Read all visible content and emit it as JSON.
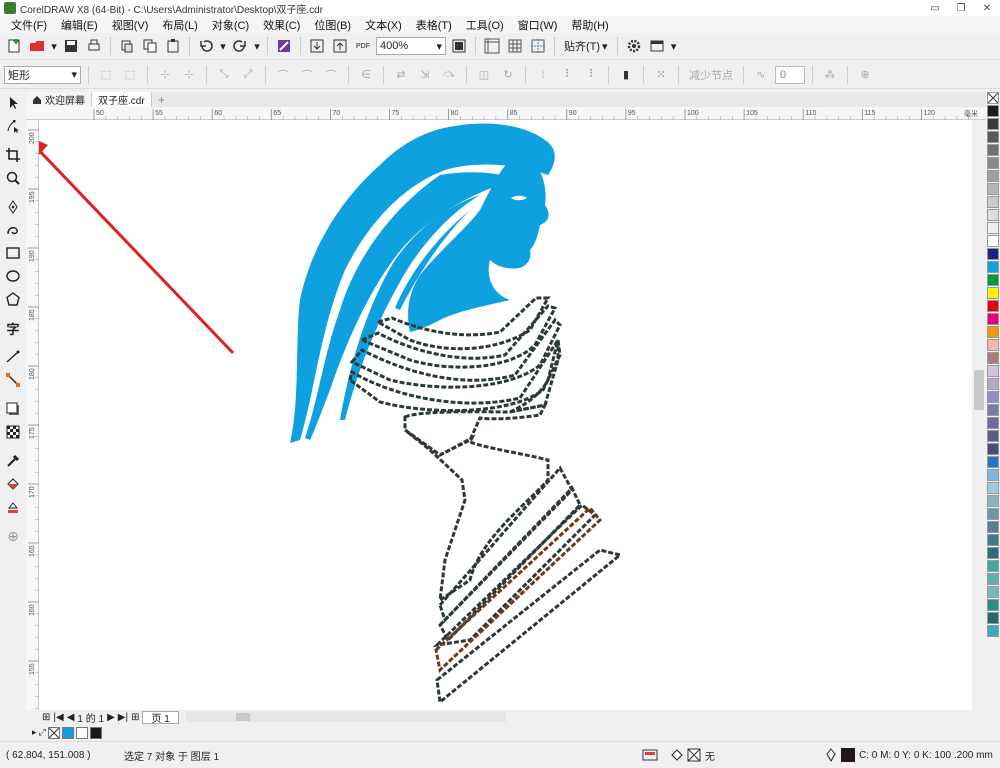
{
  "window": {
    "title": "CorelDRAW X8 (64-Bit) - C:\\Users\\Administrator\\Desktop\\双子座.cdr"
  },
  "menu": [
    "文件(F)",
    "编辑(E)",
    "视图(V)",
    "布局(L)",
    "对象(C)",
    "效果(C)",
    "位图(B)",
    "文本(X)",
    "表格(T)",
    "工具(O)",
    "窗口(W)",
    "帮助(H)"
  ],
  "toolbar": {
    "zoom_value": "400%",
    "snap_label": "贴齐(T)",
    "pdf_label": "PDF"
  },
  "property_bar": {
    "shape_type": "矩形",
    "reduce_nodes_label": "减少节点",
    "curve_smoothness": "0"
  },
  "tabs": [
    {
      "label": "欢迎屏幕"
    },
    {
      "label": "双子座.cdr"
    }
  ],
  "ruler": {
    "h_ticks": [
      "50",
      "55",
      "60",
      "65",
      "70",
      "75",
      "80",
      "85",
      "90",
      "95",
      "100",
      "105",
      "110",
      "115",
      "120"
    ],
    "h_unit": "毫米",
    "v_ticks": [
      "200",
      "195",
      "190",
      "185",
      "180",
      "175",
      "170",
      "165",
      "160",
      "155"
    ]
  },
  "page_nav": {
    "page_counter": "1 的 1",
    "page_tab": "页 1"
  },
  "status": {
    "coordinates": "( 62.804, 151.008 )",
    "selection": "选定 7 对象 于 图层 1",
    "fill_none": "无",
    "outline_info": "C: 0 M: 0 Y: 0 K: 100  .200 mm"
  },
  "colors": {
    "illustration_fill": "#0fa0e0",
    "annotation_red": "#e02020",
    "outline_dark": "#2b3a38",
    "outline_brown": "#6b3a20"
  },
  "palette_colors": [
    "#231815",
    "#3e3a39",
    "#595757",
    "#727171",
    "#898989",
    "#9fa0a0",
    "#b5b5b6",
    "#c9caca",
    "#dcdddd",
    "#efefef",
    "#ffffff",
    "#1d2088",
    "#0fa0e0",
    "#009944",
    "#fff100",
    "#e60012",
    "#e4007f",
    "#f39800",
    "#f4b4b4",
    "#a67d7d",
    "#d2c2de",
    "#b5a8d0",
    "#8d8cc4",
    "#7b7ab0",
    "#6c6a9e",
    "#5b5b8e",
    "#4a4a7e",
    "#1e78c2",
    "#7fb6e5",
    "#a8c8dc",
    "#8cb0c4",
    "#6e94aa",
    "#587e94",
    "#3f7a8c",
    "#2f6b78",
    "#47a4a4",
    "#5cb0b0",
    "#70bcbc",
    "#2a8c8c",
    "#1f6e6e",
    "#3fa9b8"
  ]
}
